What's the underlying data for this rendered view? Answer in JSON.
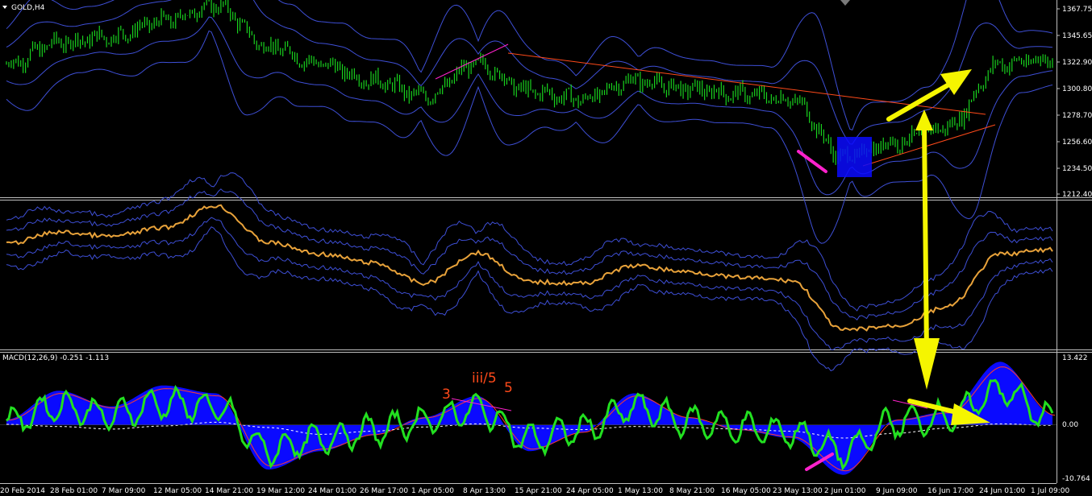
{
  "window": {
    "symbol_title": "GOLD,H4",
    "menu_icon": "triangle-down-icon"
  },
  "panes": {
    "price": {
      "y_ticks": [
        "1367.75",
        "1345.65",
        "1322.90",
        "1300.80",
        "1278.70",
        "1256.60",
        "1234.50",
        "1212.40"
      ],
      "ylim": [
        1212.4,
        1367.75
      ]
    },
    "macd": {
      "title": "MACD(12,26,9) -0.251 -1.113",
      "y_ticks": [
        "13.422",
        "0.00",
        "-10.764"
      ],
      "ylim": [
        -10.764,
        13.422
      ]
    }
  },
  "x_ticks": [
    "20 Feb 2014",
    "28 Feb 01:00",
    "7 Mar 09:00",
    "12 Mar 05:00",
    "14 Mar 21:00",
    "19 Mar 12:00",
    "24 Mar 01:00",
    "26 Mar 17:00",
    "1 Apr 05:00",
    "8 Apr 13:00",
    "15 Apr 21:00",
    "24 Apr 05:00",
    "1 May 13:00",
    "8 May 21:00",
    "16 May 05:00",
    "23 May 13:00",
    "2 Jun 01:00",
    "9 Jun 09:00",
    "16 Jun 17:00",
    "24 Jun 01:00",
    "1 Jul 09:00"
  ],
  "annotations": {
    "wave_labels": [
      "3",
      "iii/5",
      "5"
    ]
  },
  "colors": {
    "background": "#000000",
    "price_bars": "#19d21e",
    "bands": "#3e4fd6",
    "secondary_line": "#e8a23a",
    "macd_hist": "#0a0aff",
    "macd_line": "#22e020",
    "trend_line": "#ff4a1a",
    "arrow": "#f5f500",
    "magenta": "#ff22cc",
    "grid_line": "#c0c0c0"
  },
  "chart_data": [
    {
      "type": "line",
      "name": "price",
      "symbol": "GOLD",
      "timeframe": "H4",
      "x": [
        "20 Feb 2014",
        "28 Feb 01:00",
        "7 Mar 09:00",
        "12 Mar 05:00",
        "14 Mar 21:00",
        "19 Mar 12:00",
        "24 Mar 01:00",
        "26 Mar 17:00",
        "1 Apr 05:00",
        "8 Apr 13:00",
        "15 Apr 21:00",
        "24 Apr 05:00",
        "1 May 13:00",
        "8 May 21:00",
        "16 May 05:00",
        "23 May 13:00",
        "2 Jun 01:00",
        "9 Jun 09:00",
        "16 Jun 17:00",
        "24 Jun 01:00",
        "1 Jul 09:00"
      ],
      "values": [
        1318,
        1335,
        1340,
        1352,
        1365,
        1332,
        1318,
        1305,
        1292,
        1318,
        1296,
        1290,
        1305,
        1298,
        1294,
        1290,
        1244,
        1256,
        1268,
        1318,
        1322
      ],
      "ylim": [
        1212.4,
        1367.75
      ]
    },
    {
      "type": "line",
      "name": "secondary",
      "x": [
        "20 Feb 2014",
        "28 Feb 01:00",
        "7 Mar 09:00",
        "12 Mar 05:00",
        "14 Mar 21:00",
        "19 Mar 12:00",
        "24 Mar 01:00",
        "26 Mar 17:00",
        "1 Apr 05:00",
        "8 Apr 13:00",
        "15 Apr 21:00",
        "24 Apr 05:00",
        "1 May 13:00",
        "8 May 21:00",
        "16 May 05:00",
        "23 May 13:00",
        "2 Jun 01:00",
        "9 Jun 09:00",
        "16 Jun 17:00",
        "24 Jun 01:00",
        "1 Jul 09:00"
      ],
      "values": [
        0.29,
        0.21,
        0.24,
        0.18,
        0.03,
        0.28,
        0.36,
        0.42,
        0.56,
        0.35,
        0.55,
        0.56,
        0.44,
        0.48,
        0.52,
        0.54,
        0.88,
        0.85,
        0.72,
        0.36,
        0.33
      ],
      "ylim": [
        0,
        1
      ]
    },
    {
      "type": "area",
      "name": "MACD(12,26,9)",
      "x": [
        "20 Feb 2014",
        "28 Feb 01:00",
        "7 Mar 09:00",
        "12 Mar 05:00",
        "14 Mar 21:00",
        "19 Mar 12:00",
        "24 Mar 01:00",
        "26 Mar 17:00",
        "1 Apr 05:00",
        "8 Apr 13:00",
        "15 Apr 21:00",
        "24 Apr 05:00",
        "1 May 13:00",
        "8 May 21:00",
        "16 May 05:00",
        "23 May 13:00",
        "2 Jun 01:00",
        "9 Jun 09:00",
        "16 Jun 17:00",
        "24 Jun 01:00",
        "1 Jul 09:00"
      ],
      "values": [
        1.0,
        6.5,
        3.5,
        7.5,
        6.0,
        -8.5,
        -5.0,
        -2.0,
        1.5,
        5.5,
        -5.0,
        -1.5,
        6.0,
        1.5,
        -1.0,
        -2.5,
        -9.5,
        1.0,
        2.5,
        12.0,
        2.0
      ],
      "signal_values": [
        0.1,
        -0.3,
        -0.8,
        -0.2,
        0.5,
        -0.5,
        -1.8,
        -1.2,
        -0.4,
        0.2,
        -0.6,
        -0.9,
        -0.3,
        -0.5,
        -0.8,
        -1.2,
        -2.5,
        -1.6,
        -0.6,
        0.2,
        -0.1
      ],
      "current_values": {
        "macd": -0.251,
        "signal": -1.113
      },
      "ylim": [
        -10.764,
        13.422
      ]
    }
  ]
}
